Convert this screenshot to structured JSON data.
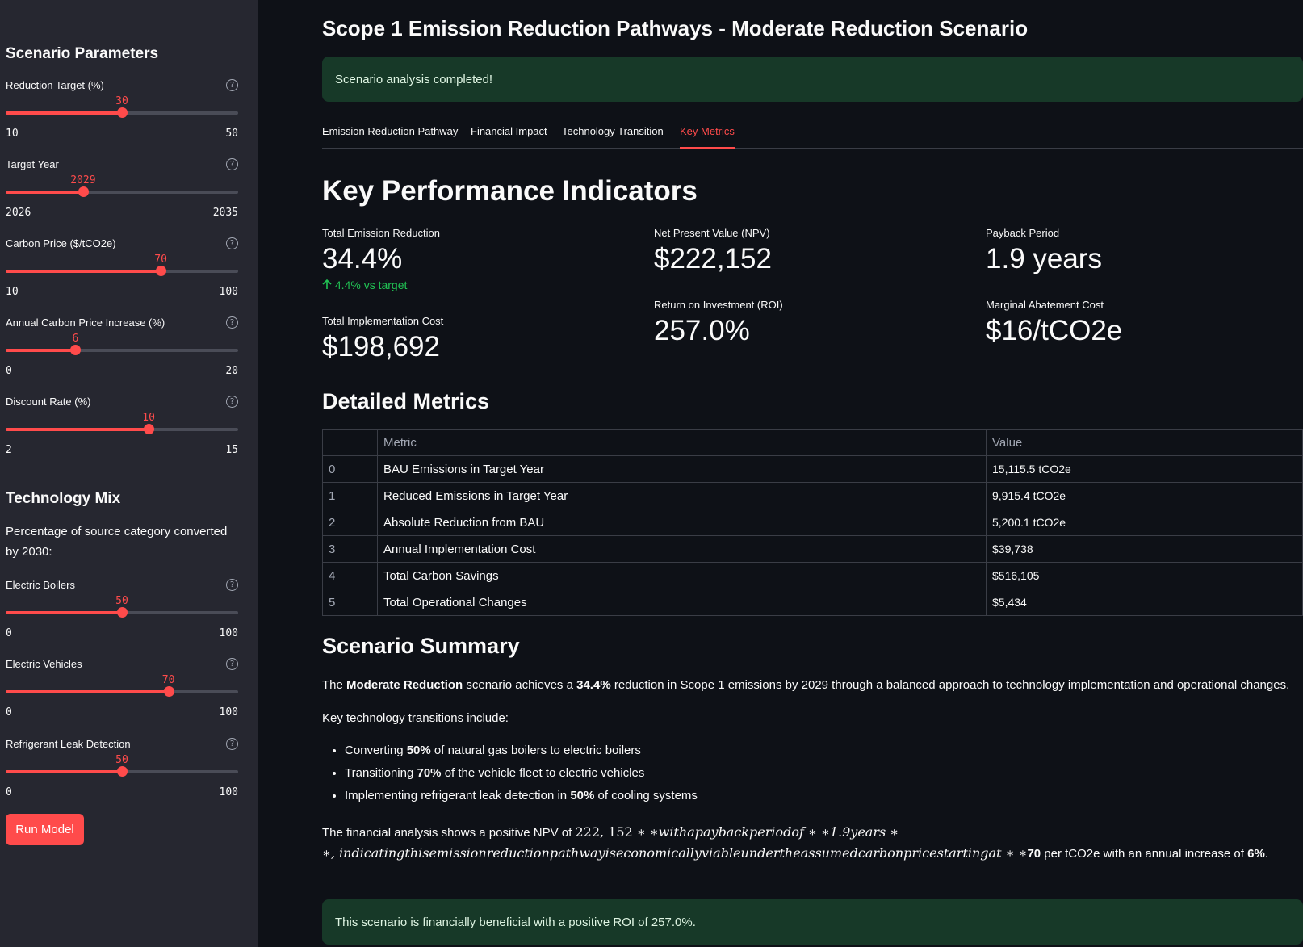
{
  "sidebar": {
    "scenario_header": "Scenario Parameters",
    "sliders": [
      {
        "label": "Reduction Target (%)",
        "value": "30",
        "min": "10",
        "max": "50",
        "fraction": 0.5
      },
      {
        "label": "Target Year",
        "value": "2029",
        "min": "2026",
        "max": "2035",
        "fraction": 0.333
      },
      {
        "label": "Carbon Price ($/tCO2e)",
        "value": "70",
        "min": "10",
        "max": "100",
        "fraction": 0.667
      },
      {
        "label": "Annual Carbon Price Increase (%)",
        "value": "6",
        "min": "0",
        "max": "20",
        "fraction": 0.3
      },
      {
        "label": "Discount Rate (%)",
        "value": "10",
        "min": "2",
        "max": "15",
        "fraction": 0.615
      }
    ],
    "tech_header": "Technology Mix",
    "tech_desc": "Percentage of source category converted by 2030:",
    "tech_sliders": [
      {
        "label": "Electric Boilers",
        "value": "50",
        "min": "0",
        "max": "100",
        "fraction": 0.5
      },
      {
        "label": "Electric Vehicles",
        "value": "70",
        "min": "0",
        "max": "100",
        "fraction": 0.7
      },
      {
        "label": "Refrigerant Leak Detection",
        "value": "50",
        "min": "0",
        "max": "100",
        "fraction": 0.5
      }
    ],
    "help_icon_glyph": "?",
    "run_button": "Run Model"
  },
  "main": {
    "title": "Scope 1 Emission Reduction Pathways - Moderate Reduction Scenario",
    "success_message": "Scenario analysis completed!",
    "tabs": [
      "Emission Reduction Pathway",
      "Financial Impact",
      "Technology Transition",
      "Key Metrics"
    ],
    "active_tab": "Key Metrics",
    "kpi_header": "Key Performance Indicators",
    "metrics": {
      "total_emission_reduction": {
        "label": "Total Emission Reduction",
        "value": "34.4%",
        "delta": "4.4% vs target"
      },
      "total_implementation_cost": {
        "label": "Total Implementation Cost",
        "value": "$198,692"
      },
      "npv": {
        "label": "Net Present Value (NPV)",
        "value": "$222,152"
      },
      "roi": {
        "label": "Return on Investment (ROI)",
        "value": "257.0%"
      },
      "payback": {
        "label": "Payback Period",
        "value": "1.9 years"
      },
      "mac": {
        "label": "Marginal Abatement Cost",
        "value": "$16/tCO2e"
      }
    },
    "delta_icon": "arrow-up-icon",
    "detailed_header": "Detailed Metrics",
    "table": {
      "columns": [
        "",
        "Metric",
        "Value"
      ],
      "rows": [
        {
          "index": "0",
          "metric": "BAU Emissions in Target Year",
          "value": "15,115.5 tCO2e"
        },
        {
          "index": "1",
          "metric": "Reduced Emissions in Target Year",
          "value": "9,915.4 tCO2e"
        },
        {
          "index": "2",
          "metric": "Absolute Reduction from BAU",
          "value": "5,200.1 tCO2e"
        },
        {
          "index": "3",
          "metric": "Annual Implementation Cost",
          "value": "$39,738"
        },
        {
          "index": "4",
          "metric": "Total Carbon Savings",
          "value": "$516,105"
        },
        {
          "index": "5",
          "metric": "Total Operational Changes",
          "value": "$5,434"
        }
      ]
    },
    "summary_header": "Scenario Summary",
    "summary": {
      "p1_a": "The ",
      "p1_b": "Moderate Reduction",
      "p1_c": " scenario achieves a ",
      "p1_d": "34.4%",
      "p1_e": " reduction in Scope 1 emissions by 2029 through a balanced approach to technology implementation and operational changes.",
      "p2": "Key technology transitions include:",
      "bullets": [
        {
          "pre": "Converting ",
          "bold": "50%",
          "post": " of natural gas boilers to electric boilers"
        },
        {
          "pre": "Transitioning ",
          "bold": "70%",
          "post": " of the vehicle fleet to electric vehicles"
        },
        {
          "pre": "Implementing refrigerant leak detection in ",
          "bold": "50%",
          "post": " of cooling systems"
        }
      ],
      "p3_a": "The financial analysis shows a positive NPV of ",
      "p3_math1": "222, 152",
      "p3_math2": " ∗ ∗withapaybackperiodof ∗ ∗1.9years ∗",
      "p3_math3": "∗, indicatingthisemissionreductionpathwayiseconomicallyviableundertheassumedcarbonpricestartingat ∗ ∗",
      "p3_b": "70",
      "p3_c": " per tCO2e with an annual increase of ",
      "p3_d": "6%",
      "p3_e": "."
    },
    "roi_message": "This scenario is financially beneficial with a positive ROI of 257.0%."
  },
  "colors": {
    "accent": "#ff4b4b",
    "success_bg": "#173928",
    "delta_green": "#21c354",
    "sidebar_bg": "#262730",
    "main_bg": "#0e1117"
  }
}
